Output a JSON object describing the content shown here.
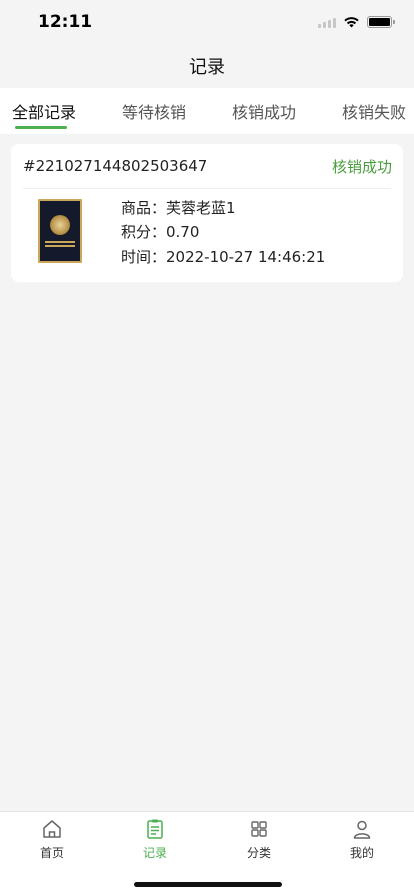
{
  "status_bar": {
    "time": "12:11"
  },
  "nav": {
    "title": "记录"
  },
  "tabs": [
    {
      "label": "全部记录",
      "active": true
    },
    {
      "label": "等待核销",
      "active": false
    },
    {
      "label": "核销成功",
      "active": false
    },
    {
      "label": "核销失败",
      "active": false
    }
  ],
  "records": [
    {
      "order_no": "#221027144802503647",
      "status": "核销成功",
      "product_line": "商品：芙蓉老蓝1",
      "points_line": "积分：0.70",
      "time_line": "时间：2022-10-27 14:46:21",
      "image_icon": "cigarette-pack-image"
    }
  ],
  "tabbar": [
    {
      "label": "首页",
      "icon": "home-icon",
      "active": false
    },
    {
      "label": "记录",
      "icon": "record-icon",
      "active": true
    },
    {
      "label": "分类",
      "icon": "category-icon",
      "active": false
    },
    {
      "label": "我的",
      "icon": "profile-icon",
      "active": false
    }
  ],
  "colors": {
    "accent": "#4caf50",
    "status_success": "#4a9d3d",
    "background": "#f4f4f4"
  }
}
